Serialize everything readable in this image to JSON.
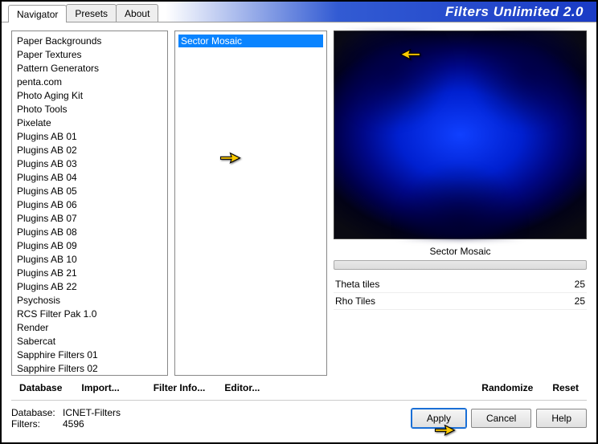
{
  "header": {
    "title": "Filters Unlimited 2.0",
    "tabs": [
      {
        "label": "Navigator",
        "active": true
      },
      {
        "label": "Presets",
        "active": false
      },
      {
        "label": "About",
        "active": false
      }
    ]
  },
  "categories": [
    "Paper Backgrounds",
    "Paper Textures",
    "Pattern Generators",
    "penta.com",
    "Photo Aging Kit",
    "Photo Tools",
    "Pixelate",
    "Plugins AB 01",
    "Plugins AB 02",
    "Plugins AB 03",
    "Plugins AB 04",
    "Plugins AB 05",
    "Plugins AB 06",
    "Plugins AB 07",
    "Plugins AB 08",
    "Plugins AB 09",
    "Plugins AB 10",
    "Plugins AB 21",
    "Plugins AB 22",
    "Psychosis",
    "RCS Filter Pak 1.0",
    "Render",
    "Sabercat",
    "Sapphire Filters 01",
    "Sapphire Filters 02"
  ],
  "highlighted_category_index": 6,
  "filters": [
    {
      "label": "Sector Mosaic",
      "selected": true
    }
  ],
  "preview": {
    "filter_name": "Sector Mosaic"
  },
  "params": [
    {
      "name": "Theta tiles",
      "value": "25"
    },
    {
      "name": "Rho Tiles",
      "value": "25"
    }
  ],
  "toolbar": {
    "database": "Database",
    "import": "Import...",
    "filter_info": "Filter Info...",
    "editor": "Editor...",
    "randomize": "Randomize",
    "reset": "Reset"
  },
  "status": {
    "db_label": "Database:",
    "db_value": "ICNET-Filters",
    "filters_label": "Filters:",
    "filters_value": "4596"
  },
  "actions": {
    "apply": "Apply",
    "cancel": "Cancel",
    "help": "Help"
  }
}
